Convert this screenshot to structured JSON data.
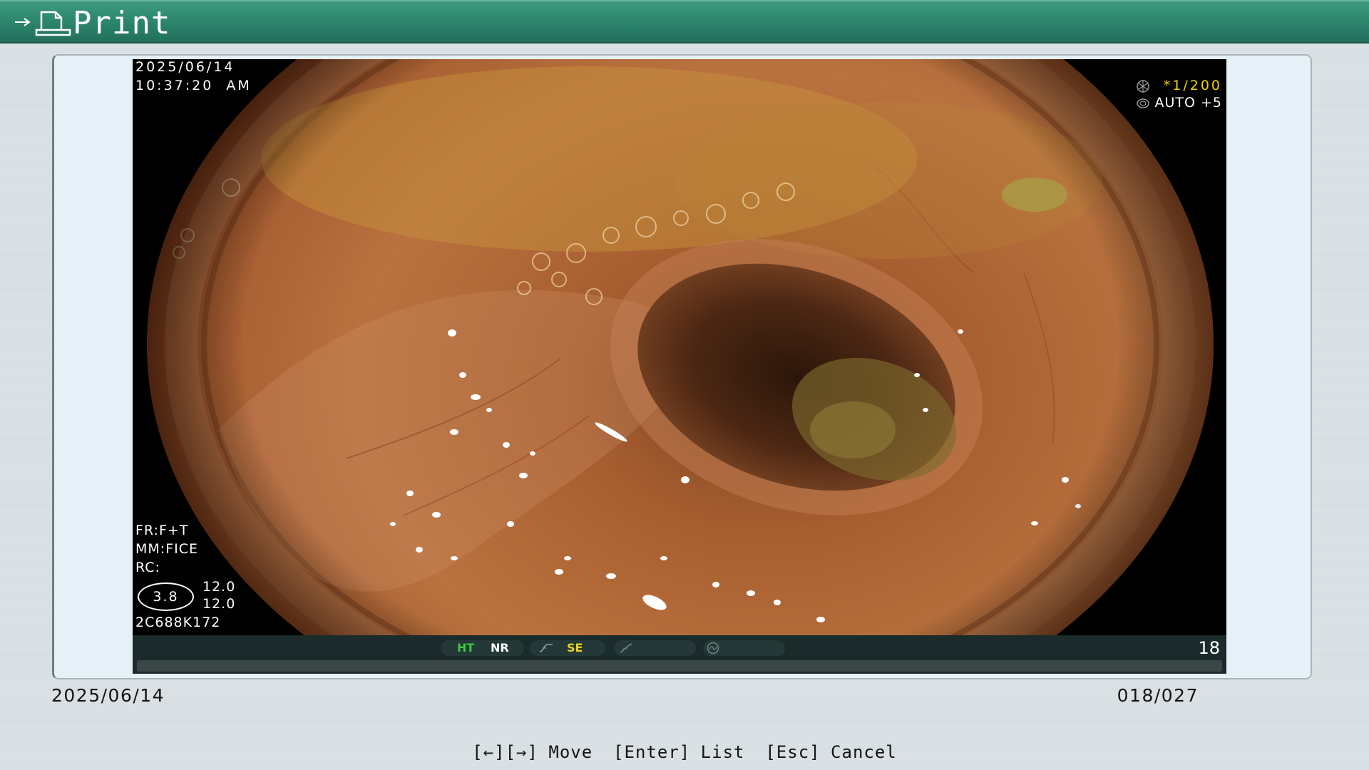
{
  "header": {
    "title": "Print"
  },
  "image_overlay": {
    "date": "2025/06/14",
    "time": "10:37:20  AM",
    "shutter": "*1/200",
    "iris": "AUTO +5",
    "fr": "FR:F+T",
    "mm": "MM:FICE",
    "rc": "RC:",
    "zoom": "3.8",
    "value_1": "12.0",
    "value_2": "12.0",
    "scope_id": "2C688K172"
  },
  "status_bar": {
    "ht": "HT",
    "nr": "NR",
    "se": "SE",
    "frame_number": "18"
  },
  "footer": {
    "date": "2025/06/14",
    "counter": "018/027"
  },
  "hints": [
    {
      "key": "[←][→]",
      "label": "Move"
    },
    {
      "key": "[Enter]",
      "label": "List"
    },
    {
      "key": "[Esc]",
      "label": "Cancel"
    }
  ],
  "icons": {
    "header_arrow": "arrow-right-icon",
    "header_print": "print-icon",
    "shutter": "shutter-icon",
    "iris": "iris-icon",
    "gamma": "gamma-curve-icon",
    "enhance": "enhance-curve-icon",
    "record": "record-icon"
  },
  "colors": {
    "header": "#2b836b",
    "ht": "#3ec83e",
    "nr": "#ffffff",
    "se": "#e8d320",
    "shutter": "#f2d100"
  }
}
